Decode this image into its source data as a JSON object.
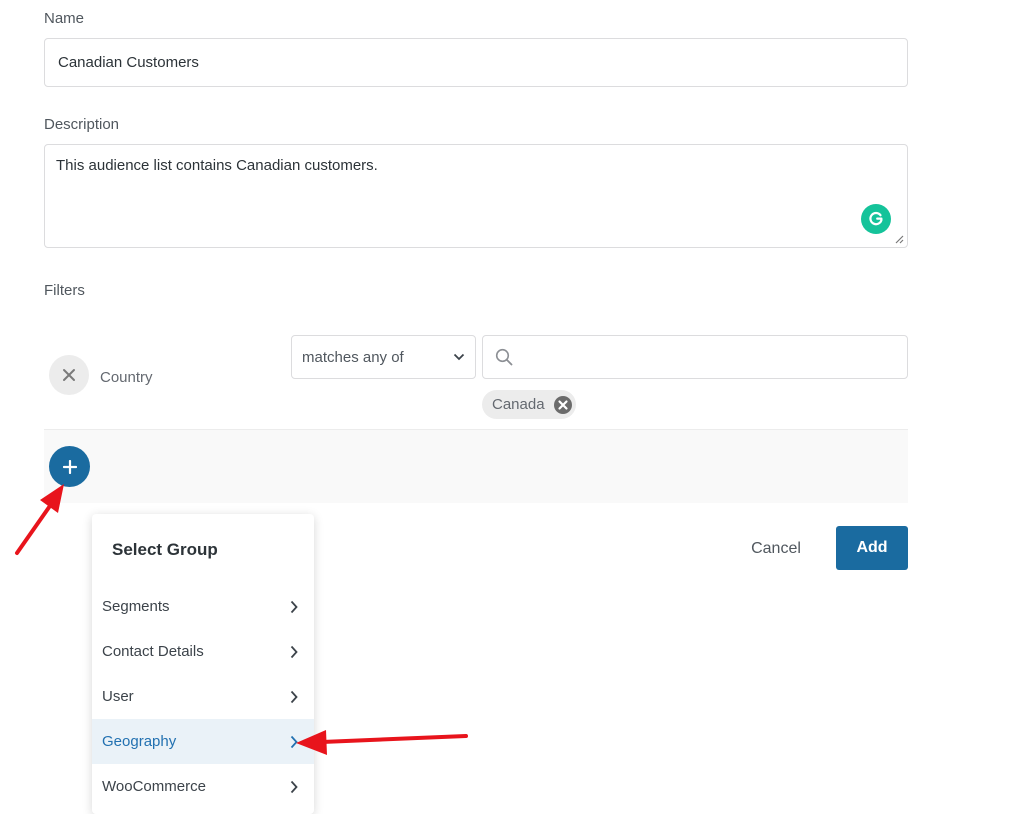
{
  "form": {
    "name_label": "Name",
    "name_value": "Canadian Customers",
    "description_label": "Description",
    "description_value": "This audience list contains Canadian customers.",
    "filters_label": "Filters"
  },
  "filter": {
    "field": "Country",
    "operator": "matches any of",
    "search_placeholder": "",
    "tags": [
      "Canada"
    ]
  },
  "actions": {
    "cancel_label": "Cancel",
    "add_label": "Add"
  },
  "dropdown": {
    "title": "Select Group",
    "items": [
      {
        "label": "Segments"
      },
      {
        "label": "Contact Details"
      },
      {
        "label": "User"
      },
      {
        "label": "Geography"
      },
      {
        "label": "WooCommerce"
      }
    ],
    "active_item": "Geography"
  },
  "colors": {
    "accent": "#1a6ba0",
    "active_text": "#2271b1",
    "active_bg": "#eaf2f8",
    "grammarly": "#15c39a",
    "annotation_arrow": "#e8141c"
  },
  "icons": {
    "remove_filter": "close-icon",
    "search": "search-icon",
    "operator_chevron": "chevron-down-icon",
    "tag_remove": "close-circle-icon",
    "add_filter": "plus-icon",
    "menu_chevron": "chevron-right-icon",
    "grammarly": "grammarly-icon"
  }
}
